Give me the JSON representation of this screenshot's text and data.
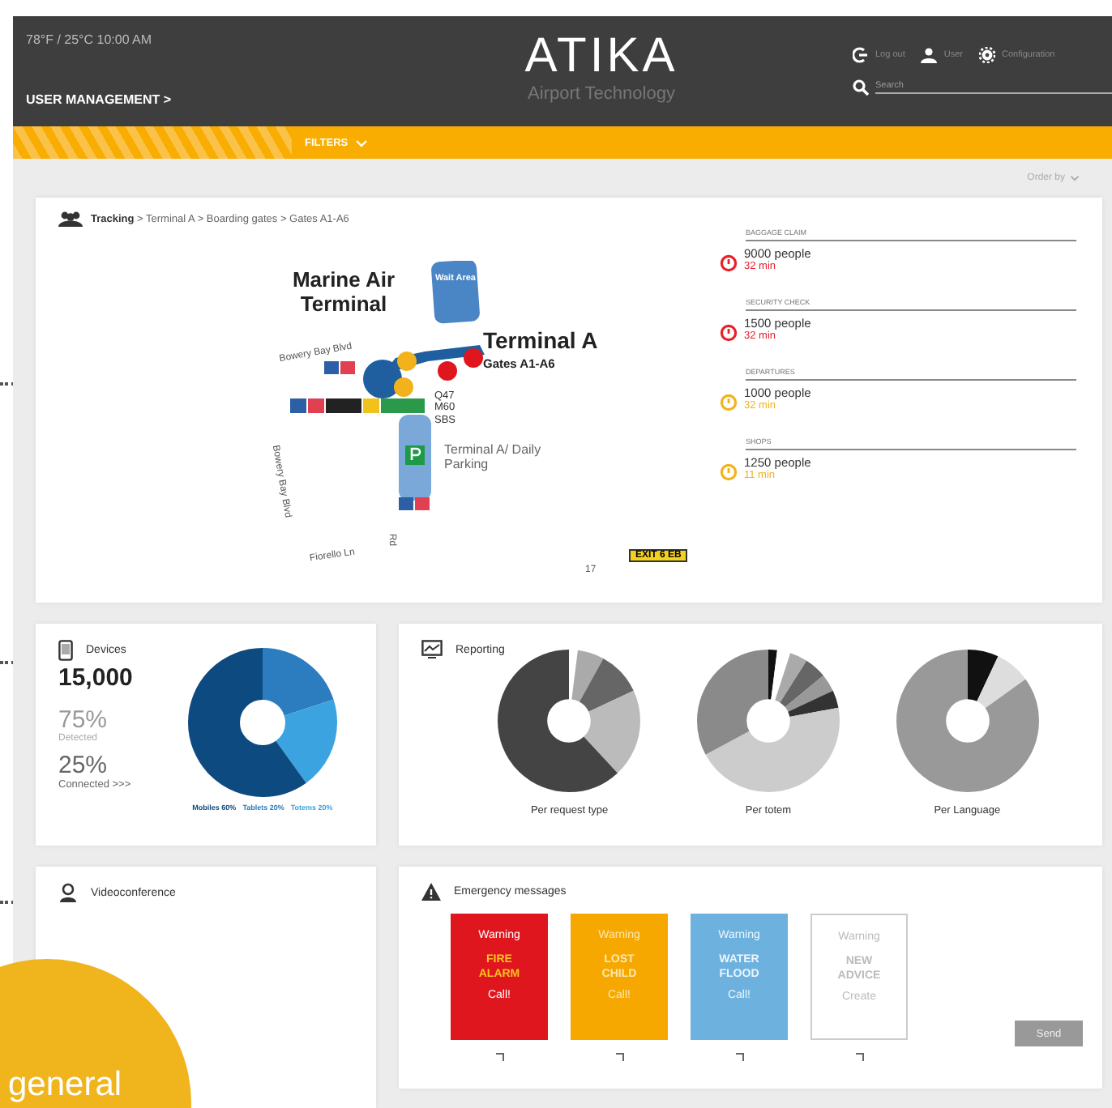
{
  "header": {
    "weather_time": "78°F / 25°C 10:00 AM",
    "menu": "USER MANAGEMENT >",
    "logo": "ATIKA",
    "tagline": "Airport Technology",
    "actions": [
      {
        "kind": "logout",
        "label": "Log out"
      },
      {
        "kind": "user",
        "label": "User"
      },
      {
        "kind": "settings",
        "label": "Configuration"
      }
    ],
    "search": {
      "placeholder": "Search"
    }
  },
  "filter_bar": {
    "label": "FILTERS"
  },
  "sort": {
    "label": "Order by"
  },
  "tracking": {
    "breadcrumb": "**Tracking** > Terminal A > Boarding gates > Gates A1-A6",
    "map_labels": [
      "Marine Air Terminal",
      "Wait Area",
      "Terminal A",
      "Gates A1-A6",
      "Bowery Bay Blvd",
      "Q47 M60 SBS",
      "Terminal A/ Daily Parking",
      "Bowery Bay Blvd",
      "Fiorello Ln",
      "Rd",
      "17"
    ],
    "exit_sign": "EXIT 6 EB",
    "areas": [
      {
        "label": "BAGGAGE CLAIM",
        "people": "9000 people",
        "wait": "32 min",
        "color": "#e8202a"
      },
      {
        "label": "SECURITY CHECK",
        "people": "1500 people",
        "wait": "32 min",
        "color": "#e8202a"
      },
      {
        "label": "DEPARTURES",
        "people": "1000 people",
        "wait": "32 min",
        "color": "#f2b21c"
      },
      {
        "label": "SHOPS",
        "people": "1250 people",
        "wait": "11 min",
        "color": "#f2b21c"
      }
    ]
  },
  "devices": {
    "title": "Devices",
    "total": "15,000",
    "detected_pct": "75%",
    "detected_label": "Detected",
    "connected_pct": "25%",
    "connected_label": "Connected >>>",
    "legend": [
      {
        "label": "Mobiles 60%",
        "color": "#0d4a80"
      },
      {
        "label": "Tablets 20%",
        "color": "#2b7dc0"
      },
      {
        "label": "Totems 20%",
        "color": "#3aa3e0"
      }
    ]
  },
  "reporting": {
    "title": "Reporting",
    "charts": [
      {
        "label": "Per request type"
      },
      {
        "label": "Per totem"
      },
      {
        "label": "Per Language"
      }
    ]
  },
  "videoconference": {
    "title": "Videoconference"
  },
  "emergency": {
    "title": "Emergency messages",
    "cards": [
      {
        "kind": "fire",
        "title": "Warning",
        "message": "FIRE ALARM",
        "action": "Call!",
        "checked": false
      },
      {
        "kind": "lost",
        "title": "Warning",
        "message": "LOST CHILD",
        "action": "Call!",
        "checked": false
      },
      {
        "kind": "water",
        "title": "Warning",
        "message": "WATER FLOOD",
        "action": "Call!",
        "checked": false
      },
      {
        "kind": "new",
        "title": "Warning",
        "message": "NEW ADVICE",
        "action": "Create",
        "checked": false
      }
    ],
    "send": "Send"
  },
  "badge": "general"
}
